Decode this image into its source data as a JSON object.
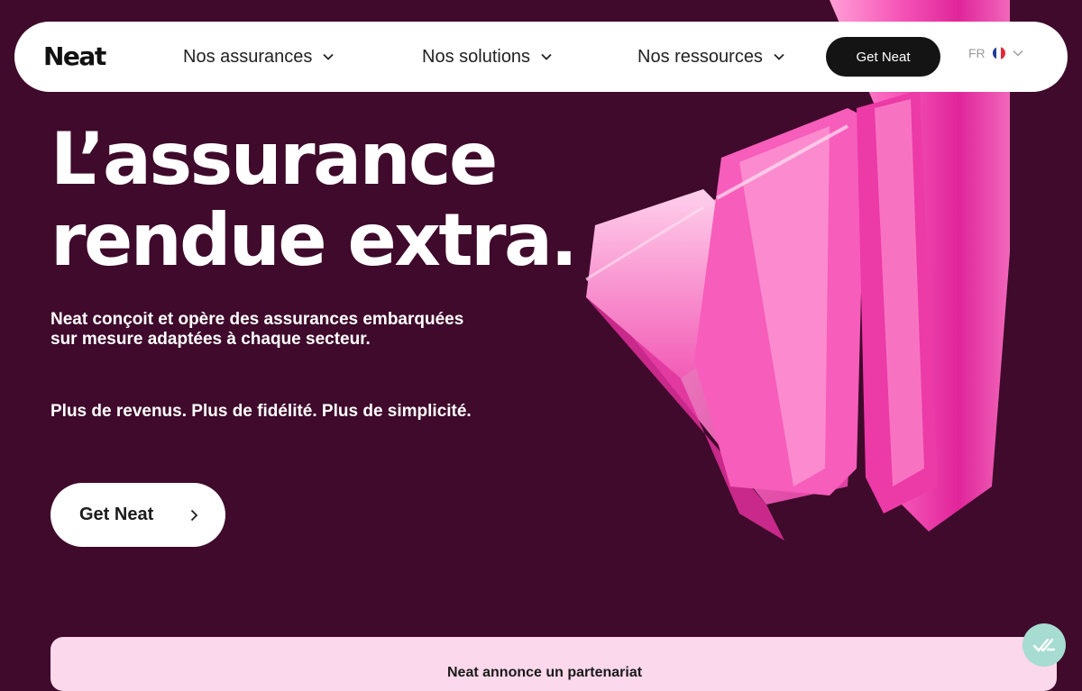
{
  "brand": {
    "logo_text": "Neat"
  },
  "nav": {
    "items": [
      {
        "label": "Nos assurances",
        "icon": "chevron-down-icon"
      },
      {
        "label": "Nos solutions",
        "icon": "chevron-down-icon"
      },
      {
        "label": "Nos ressources",
        "icon": "chevron-down-icon"
      }
    ],
    "cta_label": "Get Neat",
    "language": {
      "code": "FR",
      "flag_icon": "france-flag-icon",
      "icon": "chevron-down-icon"
    }
  },
  "hero": {
    "title_line1": "L’assurance",
    "title_line2": "rendue extra.",
    "description": "Neat conçoit et opère des assurances embarquées sur mesure adaptées à chaque secteur.",
    "tagline": "Plus de revenus. Plus de fidélité. Plus de simplicité.",
    "cta_label": "Get Neat",
    "cta_icon": "chevron-right-icon"
  },
  "announcement": {
    "text": "Neat annonce un partenariat"
  },
  "widget": {
    "icon": "checkmark-chat-icon"
  },
  "colors": {
    "background": "#3f0a2b",
    "accent_pink": "#f45fb8",
    "announcement_bg": "#fcd8ec",
    "widget_bg": "#a6dcd2"
  }
}
